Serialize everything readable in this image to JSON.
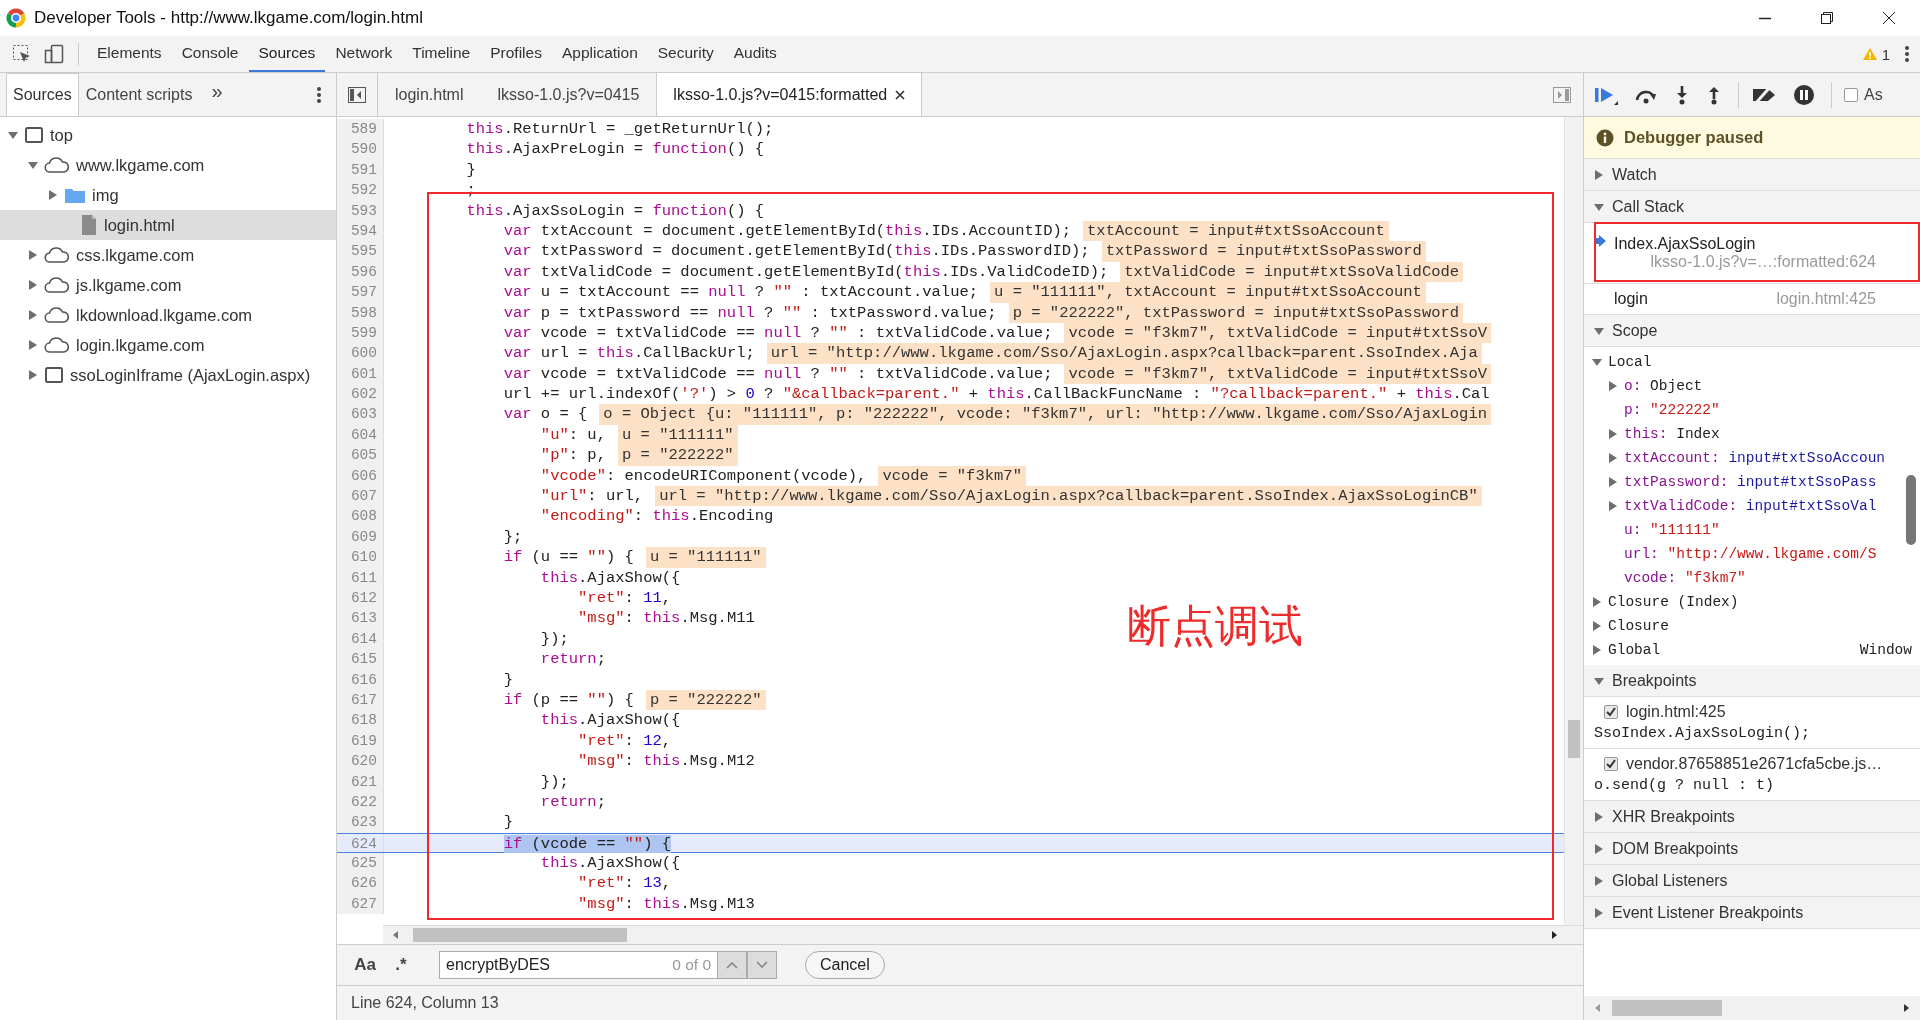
{
  "window": {
    "title": "Developer Tools - http://www.lkgame.com/login.html"
  },
  "toolbar": {
    "tabs": [
      {
        "label": "Elements",
        "selected": false
      },
      {
        "label": "Console",
        "selected": false
      },
      {
        "label": "Sources",
        "selected": true
      },
      {
        "label": "Network",
        "selected": false
      },
      {
        "label": "Timeline",
        "selected": false
      },
      {
        "label": "Profiles",
        "selected": false
      },
      {
        "label": "Application",
        "selected": false
      },
      {
        "label": "Security",
        "selected": false
      },
      {
        "label": "Audits",
        "selected": false
      }
    ],
    "warning_count": "1"
  },
  "navigator": {
    "tabs": [
      {
        "label": "Sources",
        "selected": true
      },
      {
        "label": "Content scripts",
        "selected": false
      }
    ],
    "more": "»",
    "tree": [
      {
        "label": "top",
        "kind": "frame",
        "expanded": true,
        "selected": false,
        "children": [
          {
            "label": "www.lkgame.com",
            "kind": "domain",
            "expanded": true,
            "selected": false,
            "children": [
              {
                "label": "img",
                "kind": "folder",
                "expanded": false,
                "selected": false
              },
              {
                "label": "login.html",
                "kind": "file",
                "expanded": false,
                "selected": true
              }
            ]
          },
          {
            "label": "css.lkgame.com",
            "kind": "domain",
            "expanded": false,
            "selected": false
          },
          {
            "label": "js.lkgame.com",
            "kind": "domain",
            "expanded": false,
            "selected": false
          },
          {
            "label": "lkdownload.lkgame.com",
            "kind": "domain",
            "expanded": false,
            "selected": false
          },
          {
            "label": "login.lkgame.com",
            "kind": "domain",
            "expanded": false,
            "selected": false
          },
          {
            "label": "ssoLoginIframe (AjaxLogin.aspx)",
            "kind": "frame",
            "expanded": false,
            "selected": false
          }
        ]
      }
    ]
  },
  "editor": {
    "tabs": [
      {
        "label": "login.html",
        "selected": false,
        "closable": false
      },
      {
        "label": "lksso-1.0.js?v=0415",
        "selected": false,
        "closable": false
      },
      {
        "label": "lksso-1.0.js?v=0415:formatted",
        "selected": true,
        "closable": true
      }
    ],
    "lines": [
      {
        "number": "589",
        "current": false,
        "tokens": [
          {
            "kind": "keyword",
            "text": "        this"
          },
          {
            "kind": "plain",
            "text": ".ReturnUrl = _getReturnUrl();"
          }
        ]
      },
      {
        "number": "590",
        "current": false,
        "tokens": [
          {
            "kind": "keyword",
            "text": "        this"
          },
          {
            "kind": "plain",
            "text": ".AjaxPreLogin = "
          },
          {
            "kind": "keyword",
            "text": "function"
          },
          {
            "kind": "plain",
            "text": "() {"
          }
        ]
      },
      {
        "number": "591",
        "current": false,
        "tokens": [
          {
            "kind": "plain",
            "text": "        }"
          }
        ]
      },
      {
        "number": "592",
        "current": false,
        "tokens": [
          {
            "kind": "plain",
            "text": "        ;"
          }
        ]
      },
      {
        "number": "593",
        "current": false,
        "tokens": [
          {
            "kind": "keyword",
            "text": "        this"
          },
          {
            "kind": "plain",
            "text": ".AjaxSsoLogin = "
          },
          {
            "kind": "keyword",
            "text": "function"
          },
          {
            "kind": "plain",
            "text": "() {"
          }
        ]
      },
      {
        "number": "594",
        "current": false,
        "tokens": [
          {
            "kind": "keyword",
            "text": "            var"
          },
          {
            "kind": "plain",
            "text": " txtAccount = document.getElementById("
          },
          {
            "kind": "keyword",
            "text": "this"
          },
          {
            "kind": "plain",
            "text": ".IDs.AccountID);"
          }
        ],
        "value": "txtAccount = input#txtSsoAccount"
      },
      {
        "number": "595",
        "current": false,
        "tokens": [
          {
            "kind": "keyword",
            "text": "            var"
          },
          {
            "kind": "plain",
            "text": " txtPassword = document.getElementById("
          },
          {
            "kind": "keyword",
            "text": "this"
          },
          {
            "kind": "plain",
            "text": ".IDs.PasswordID);"
          }
        ],
        "value": "txtPassword = input#txtSsoPassword"
      },
      {
        "number": "596",
        "current": false,
        "tokens": [
          {
            "kind": "keyword",
            "text": "            var"
          },
          {
            "kind": "plain",
            "text": " txtValidCode = document.getElementById("
          },
          {
            "kind": "keyword",
            "text": "this"
          },
          {
            "kind": "plain",
            "text": ".IDs.ValidCodeID);"
          }
        ],
        "value": "txtValidCode = input#txtSsoValidCode"
      },
      {
        "number": "597",
        "current": false,
        "tokens": [
          {
            "kind": "keyword",
            "text": "            var"
          },
          {
            "kind": "plain",
            "text": " u = txtAccount == "
          },
          {
            "kind": "keyword",
            "text": "null"
          },
          {
            "kind": "plain",
            "text": " ? "
          },
          {
            "kind": "string",
            "text": "\"\""
          },
          {
            "kind": "plain",
            "text": " : txtAccount.value;"
          }
        ],
        "value": "u = \"111111\", txtAccount = input#txtSsoAccount"
      },
      {
        "number": "598",
        "current": false,
        "tokens": [
          {
            "kind": "keyword",
            "text": "            var"
          },
          {
            "kind": "plain",
            "text": " p = txtPassword == "
          },
          {
            "kind": "keyword",
            "text": "null"
          },
          {
            "kind": "plain",
            "text": " ? "
          },
          {
            "kind": "string",
            "text": "\"\""
          },
          {
            "kind": "plain",
            "text": " : txtPassword.value;"
          }
        ],
        "value": "p = \"222222\", txtPassword = input#txtSsoPassword"
      },
      {
        "number": "599",
        "current": false,
        "tokens": [
          {
            "kind": "keyword",
            "text": "            var"
          },
          {
            "kind": "plain",
            "text": " vcode = txtValidCode == "
          },
          {
            "kind": "keyword",
            "text": "null"
          },
          {
            "kind": "plain",
            "text": " ? "
          },
          {
            "kind": "string",
            "text": "\"\""
          },
          {
            "kind": "plain",
            "text": " : txtValidCode.value;"
          }
        ],
        "value": "vcode = \"f3km7\", txtValidCode = input#txtSsoV"
      },
      {
        "number": "600",
        "current": false,
        "tokens": [
          {
            "kind": "keyword",
            "text": "            var"
          },
          {
            "kind": "plain",
            "text": " url = "
          },
          {
            "kind": "keyword",
            "text": "this"
          },
          {
            "kind": "plain",
            "text": ".CallBackUrl;"
          }
        ],
        "value": "url = \"http://www.lkgame.com/Sso/AjaxLogin.aspx?callback=parent.SsoIndex.Aja"
      },
      {
        "number": "601",
        "current": false,
        "tokens": [
          {
            "kind": "keyword",
            "text": "            var"
          },
          {
            "kind": "plain",
            "text": " vcode = txtValidCode == "
          },
          {
            "kind": "keyword",
            "text": "null"
          },
          {
            "kind": "plain",
            "text": " ? "
          },
          {
            "kind": "string",
            "text": "\"\""
          },
          {
            "kind": "plain",
            "text": " : txtValidCode.value;"
          }
        ],
        "value": "vcode = \"f3km7\", txtValidCode = input#txtSsoV"
      },
      {
        "number": "602",
        "current": false,
        "tokens": [
          {
            "kind": "plain",
            "text": "            url += url.indexOf("
          },
          {
            "kind": "string",
            "text": "'?'"
          },
          {
            "kind": "plain",
            "text": ") > "
          },
          {
            "kind": "number",
            "text": "0"
          },
          {
            "kind": "plain",
            "text": " ? "
          },
          {
            "kind": "string",
            "text": "\"&callback=parent.\""
          },
          {
            "kind": "plain",
            "text": " + "
          },
          {
            "kind": "keyword",
            "text": "this"
          },
          {
            "kind": "plain",
            "text": ".CallBackFuncName : "
          },
          {
            "kind": "string",
            "text": "\"?callback=parent.\""
          },
          {
            "kind": "plain",
            "text": " + "
          },
          {
            "kind": "keyword",
            "text": "this"
          },
          {
            "kind": "plain",
            "text": ".Cal"
          }
        ]
      },
      {
        "number": "603",
        "current": false,
        "tokens": [
          {
            "kind": "keyword",
            "text": "            var"
          },
          {
            "kind": "plain",
            "text": " o = {"
          }
        ],
        "value": "o = Object {u: \"111111\", p: \"222222\", vcode: \"f3km7\", url: \"http://www.lkgame.com/Sso/AjaxLogin"
      },
      {
        "number": "604",
        "current": false,
        "tokens": [
          {
            "kind": "string",
            "text": "                \"u\""
          },
          {
            "kind": "plain",
            "text": ": u,"
          }
        ],
        "value": "u = \"111111\""
      },
      {
        "number": "605",
        "current": false,
        "tokens": [
          {
            "kind": "string",
            "text": "                \"p\""
          },
          {
            "kind": "plain",
            "text": ": p,"
          }
        ],
        "value": "p = \"222222\""
      },
      {
        "number": "606",
        "current": false,
        "tokens": [
          {
            "kind": "string",
            "text": "                \"vcode\""
          },
          {
            "kind": "plain",
            "text": ": encodeURIComponent(vcode),"
          }
        ],
        "value": "vcode = \"f3km7\""
      },
      {
        "number": "607",
        "current": false,
        "tokens": [
          {
            "kind": "string",
            "text": "                \"url\""
          },
          {
            "kind": "plain",
            "text": ": url,"
          }
        ],
        "value": "url = \"http://www.lkgame.com/Sso/AjaxLogin.aspx?callback=parent.SsoIndex.AjaxSsoLoginCB\""
      },
      {
        "number": "608",
        "current": false,
        "tokens": [
          {
            "kind": "string",
            "text": "                \"encoding\""
          },
          {
            "kind": "plain",
            "text": ": "
          },
          {
            "kind": "keyword",
            "text": "this"
          },
          {
            "kind": "plain",
            "text": ".Encoding"
          }
        ]
      },
      {
        "number": "609",
        "current": false,
        "tokens": [
          {
            "kind": "plain",
            "text": "            };"
          }
        ]
      },
      {
        "number": "610",
        "current": false,
        "tokens": [
          {
            "kind": "keyword",
            "text": "            if"
          },
          {
            "kind": "plain",
            "text": " (u == "
          },
          {
            "kind": "string",
            "text": "\"\""
          },
          {
            "kind": "plain",
            "text": ") {"
          }
        ],
        "value": "u = \"111111\""
      },
      {
        "number": "611",
        "current": false,
        "tokens": [
          {
            "kind": "keyword",
            "text": "                this"
          },
          {
            "kind": "plain",
            "text": ".AjaxShow({"
          }
        ]
      },
      {
        "number": "612",
        "current": false,
        "tokens": [
          {
            "kind": "string",
            "text": "                    \"ret\""
          },
          {
            "kind": "plain",
            "text": ": "
          },
          {
            "kind": "number",
            "text": "11"
          },
          {
            "kind": "plain",
            "text": ","
          }
        ]
      },
      {
        "number": "613",
        "current": false,
        "tokens": [
          {
            "kind": "string",
            "text": "                    \"msg\""
          },
          {
            "kind": "plain",
            "text": ": "
          },
          {
            "kind": "keyword",
            "text": "this"
          },
          {
            "kind": "plain",
            "text": ".Msg.M11"
          }
        ]
      },
      {
        "number": "614",
        "current": false,
        "tokens": [
          {
            "kind": "plain",
            "text": "                });"
          }
        ]
      },
      {
        "number": "615",
        "current": false,
        "tokens": [
          {
            "kind": "keyword",
            "text": "                return"
          },
          {
            "kind": "plain",
            "text": ";"
          }
        ]
      },
      {
        "number": "616",
        "current": false,
        "tokens": [
          {
            "kind": "plain",
            "text": "            }"
          }
        ]
      },
      {
        "number": "617",
        "current": false,
        "tokens": [
          {
            "kind": "keyword",
            "text": "            if"
          },
          {
            "kind": "plain",
            "text": " (p == "
          },
          {
            "kind": "string",
            "text": "\"\""
          },
          {
            "kind": "plain",
            "text": ") {"
          }
        ],
        "value": "p = \"222222\""
      },
      {
        "number": "618",
        "current": false,
        "tokens": [
          {
            "kind": "keyword",
            "text": "                this"
          },
          {
            "kind": "plain",
            "text": ".AjaxShow({"
          }
        ]
      },
      {
        "number": "619",
        "current": false,
        "tokens": [
          {
            "kind": "string",
            "text": "                    \"ret\""
          },
          {
            "kind": "plain",
            "text": ": "
          },
          {
            "kind": "number",
            "text": "12"
          },
          {
            "kind": "plain",
            "text": ","
          }
        ]
      },
      {
        "number": "620",
        "current": false,
        "tokens": [
          {
            "kind": "string",
            "text": "                    \"msg\""
          },
          {
            "kind": "plain",
            "text": ": "
          },
          {
            "kind": "keyword",
            "text": "this"
          },
          {
            "kind": "plain",
            "text": ".Msg.M12"
          }
        ]
      },
      {
        "number": "621",
        "current": false,
        "tokens": [
          {
            "kind": "plain",
            "text": "                });"
          }
        ]
      },
      {
        "number": "622",
        "current": false,
        "tokens": [
          {
            "kind": "keyword",
            "text": "                return"
          },
          {
            "kind": "plain",
            "text": ";"
          }
        ]
      },
      {
        "number": "623",
        "current": false,
        "tokens": [
          {
            "kind": "plain",
            "text": "            }"
          }
        ]
      },
      {
        "number": "624",
        "current": true,
        "tokens": [
          {
            "kind": "keyword",
            "text": "            if"
          },
          {
            "kind": "plain",
            "text": " (vcode == "
          },
          {
            "kind": "string",
            "text": "\"\""
          },
          {
            "kind": "plain",
            "text": ") {"
          }
        ]
      },
      {
        "number": "625",
        "current": false,
        "tokens": [
          {
            "kind": "keyword",
            "text": "                this"
          },
          {
            "kind": "plain",
            "text": ".AjaxShow({"
          }
        ]
      },
      {
        "number": "626",
        "current": false,
        "tokens": [
          {
            "kind": "string",
            "text": "                    \"ret\""
          },
          {
            "kind": "plain",
            "text": ": "
          },
          {
            "kind": "number",
            "text": "13"
          },
          {
            "kind": "plain",
            "text": ","
          }
        ]
      },
      {
        "number": "627",
        "current": false,
        "tokens": [
          {
            "kind": "string",
            "text": "                    \"msg\""
          },
          {
            "kind": "plain",
            "text": ": "
          },
          {
            "kind": "keyword",
            "text": "this"
          },
          {
            "kind": "plain",
            "text": ".Msg.M13"
          }
        ]
      }
    ],
    "annotation": "断点调试",
    "search": {
      "case_label": "Aa",
      "regex_label": ".*",
      "value": "encryptByDES",
      "matches": "0 of 0",
      "cancel": "Cancel"
    },
    "status": "Line 624, Column 13"
  },
  "debugger": {
    "async_label": "As",
    "async_checked": false,
    "paused_message": "Debugger paused",
    "sections": [
      {
        "title": "Watch",
        "expanded": false
      },
      {
        "kind": "call_stack",
        "title": "Call Stack",
        "expanded": true,
        "frames": [
          {
            "name": "Index.AjaxSsoLogin",
            "location": "lksso-1.0.js?v=…:formatted:624",
            "selected": true
          },
          {
            "name": "login",
            "location": "login.html:425",
            "selected": false
          }
        ]
      },
      {
        "kind": "scope",
        "title": "Scope",
        "expanded": true,
        "groups": [
          {
            "name": "Local",
            "expanded": true,
            "variables": [
              {
                "name": "o:",
                "value": "Object",
                "kind": "object",
                "expandable": true
              },
              {
                "name": "p:",
                "value": "\"222222\"",
                "kind": "string",
                "expandable": false
              },
              {
                "name": "this:",
                "value": "Index",
                "kind": "object",
                "expandable": true
              },
              {
                "name": "txtAccount:",
                "value": "input#txtSsoAccoun",
                "kind": "node",
                "expandable": true
              },
              {
                "name": "txtPassword:",
                "value": "input#txtSsoPass",
                "kind": "node",
                "expandable": true
              },
              {
                "name": "txtValidCode:",
                "value": "input#txtSsoVal",
                "kind": "node",
                "expandable": true
              },
              {
                "name": "u:",
                "value": "\"111111\"",
                "kind": "string",
                "expandable": false
              },
              {
                "name": "url:",
                "value": "\"http://www.lkgame.com/S",
                "kind": "string",
                "expandable": false
              },
              {
                "name": "vcode:",
                "value": "\"f3km7\"",
                "kind": "string",
                "expandable": false
              }
            ]
          },
          {
            "name": "Closure (Index)",
            "expanded": false
          },
          {
            "name": "Closure",
            "expanded": false
          },
          {
            "name": "Global",
            "expanded": false,
            "value": "Window"
          }
        ]
      },
      {
        "kind": "breakpoints",
        "title": "Breakpoints",
        "expanded": true,
        "items": [
          {
            "location": "login.html:425",
            "code": "SsoIndex.AjaxSsoLogin();",
            "checked": true
          },
          {
            "location": "vendor.87658851e2671cfa5cbe.js…",
            "code": "o.send(g ? null : t)",
            "checked": true
          }
        ]
      },
      {
        "title": "XHR Breakpoints",
        "expanded": false
      },
      {
        "title": "DOM Breakpoints",
        "expanded": false
      },
      {
        "title": "Global Listeners",
        "expanded": false
      },
      {
        "title": "Event Listener Breakpoints",
        "expanded": false
      }
    ]
  }
}
